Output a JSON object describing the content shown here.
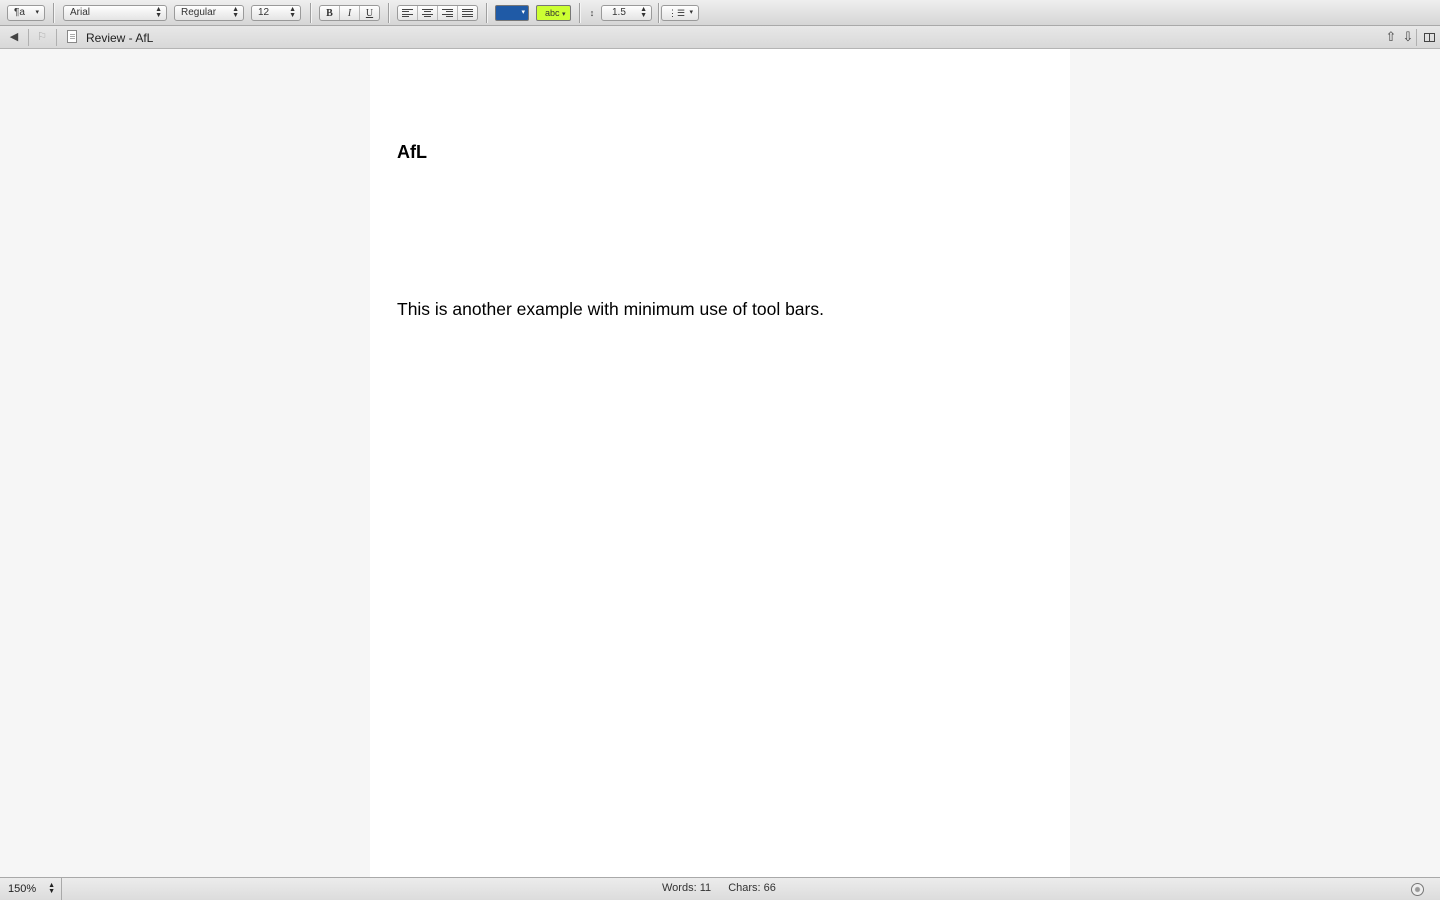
{
  "toolbar": {
    "paragraph_style": "¶a",
    "font_family": "Arial",
    "font_style": "Regular",
    "font_size": "12",
    "bold": "B",
    "italic": "I",
    "underline": "U",
    "alignment_icons": [
      "align-left-icon",
      "align-center-icon",
      "align-right-icon",
      "align-justify-icon"
    ],
    "text_color": "#1f5aa6",
    "highlight_label": "abc",
    "highlight_color": "#ccff33",
    "line_spacing": "1.5",
    "list_icon": "list-bullets-icon"
  },
  "nav": {
    "back_icon": "back-arrow-icon",
    "forward_icon": "forward-flag-icon",
    "doc_icon": "document-icon",
    "title": "Review - AfL",
    "right_icons": [
      "upload-icon",
      "download-icon",
      "split-view-icon"
    ]
  },
  "document": {
    "heading": "AfL",
    "body": "This is another example with minimum use of tool bars."
  },
  "status": {
    "zoom": "150%",
    "words": "Words: 11",
    "chars": "Chars: 66",
    "status_icon": "sync-status-icon"
  }
}
